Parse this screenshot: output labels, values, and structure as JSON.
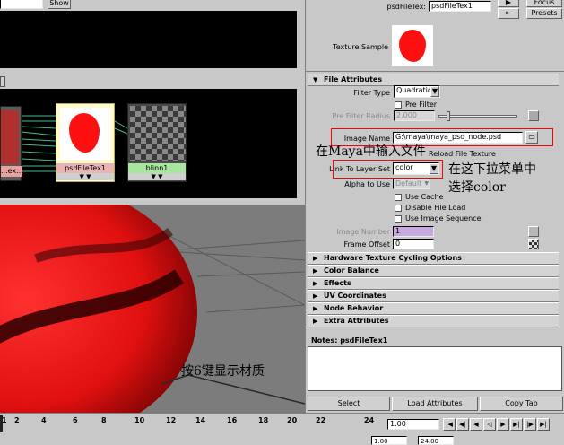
{
  "top_bar": {
    "show_button": "Show"
  },
  "hypershade": {
    "nodes": [
      {
        "label": "...ex...",
        "type": "partial"
      },
      {
        "label": "psdFileTex1",
        "type": "texture"
      },
      {
        "label": "blinn1",
        "type": "material"
      }
    ]
  },
  "attr_editor": {
    "node_field_label": "psdFileTex:",
    "node_field_value": "psdFileTex1",
    "focus_button": "Focus",
    "presets_button": "Presets",
    "texture_sample_label": "Texture Sample",
    "sections": {
      "file_attributes": "File Attributes",
      "hardware": "Hardware Texture Cycling Options",
      "color_balance": "Color Balance",
      "effects": "Effects",
      "uv_coordinates": "UV Coordinates",
      "node_behavior": "Node Behavior",
      "extra_attributes": "Extra Attributes"
    },
    "filter_type_label": "Filter Type",
    "filter_type_value": "Quadratic",
    "pre_filter_label": "Pre Filter",
    "pre_filter_radius_label": "Pre Filter Radius",
    "pre_filter_radius_value": "2.000",
    "image_name_label": "Image Name",
    "image_name_value": "G:\\maya\\maya_psd_node.psd",
    "reload_label": "Reload File Texture",
    "link_label": "Link To Layer Set",
    "link_value": "color",
    "alpha_label": "Alpha to Use",
    "alpha_value": "Default",
    "use_cache": "Use Cache",
    "disable_file_load": "Disable File Load",
    "use_image_sequence": "Use Image Sequence",
    "image_number_label": "Image Number",
    "image_number_value": "1",
    "frame_offset_label": "Frame Offset",
    "frame_offset_value": "0",
    "notes_label": "Notes: psdFileTex1",
    "buttons": {
      "select": "Select",
      "load": "Load Attributes",
      "copy": "Copy Tab"
    }
  },
  "annotations": {
    "input_file": "在Maya中输入文件",
    "dropdown_line1": "在这下拉菜单中",
    "dropdown_line2": "选择color",
    "press6": "按6键显示材质"
  },
  "timeline": {
    "ticks": [
      "1",
      "2",
      "4",
      "6",
      "8",
      "10",
      "12",
      "14",
      "16",
      "18",
      "20",
      "22",
      "24"
    ],
    "current_frame": "1.00",
    "bottom_left": "1.00",
    "bottom_right": "24.00"
  },
  "colors": {
    "highlight": "#ff0000",
    "ui_bg": "#c8c8c8",
    "panel_dark": "#000000",
    "layer_field": "#c8a8e0"
  }
}
